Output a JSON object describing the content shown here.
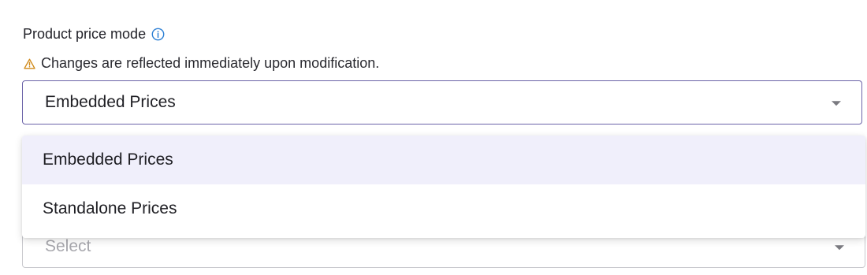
{
  "field": {
    "label": "Product price mode",
    "info_icon": "info-circle-icon",
    "warning_icon": "warning-triangle-icon",
    "warning_text": "Changes are reflected immediately upon modification."
  },
  "price_mode_select": {
    "value": "Embedded Prices",
    "options": [
      {
        "label": "Embedded Prices",
        "selected": true
      },
      {
        "label": "Standalone Prices",
        "selected": false
      }
    ]
  },
  "secondary_select": {
    "placeholder": "Select"
  },
  "colors": {
    "accent_border": "#6b63a8",
    "info_icon": "#2b7fd4",
    "warning_icon": "#d08a1a",
    "selected_option_bg": "#f0effb",
    "placeholder_text": "#a7a7ad"
  }
}
